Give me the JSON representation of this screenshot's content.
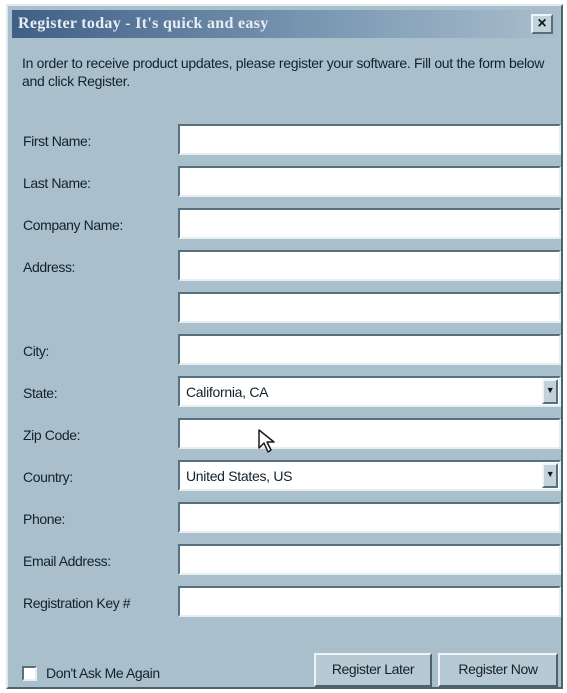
{
  "window": {
    "title": "Register today - It's quick and easy",
    "close_label": "×"
  },
  "intro_text": "In order to receive product updates, please register your software.  Fill out the form below and click Register.",
  "fields": {
    "first_name": {
      "label": "First Name:",
      "value": ""
    },
    "last_name": {
      "label": "Last Name:",
      "value": ""
    },
    "company_name": {
      "label": "Company Name:",
      "value": ""
    },
    "address": {
      "label": "Address:",
      "value": "",
      "value2": ""
    },
    "city": {
      "label": "City:",
      "value": ""
    },
    "state": {
      "label": "State:",
      "value": "California, CA"
    },
    "zip_code": {
      "label": "Zip Code:",
      "value": ""
    },
    "country": {
      "label": "Country:",
      "value": "United States, US"
    },
    "phone": {
      "label": "Phone:",
      "value": ""
    },
    "email": {
      "label": "Email Address:",
      "value": ""
    },
    "reg_key": {
      "label": "Registration Key #",
      "value": ""
    }
  },
  "footer": {
    "dont_ask_label": "Don't Ask Me Again",
    "dont_ask_checked": false,
    "register_later_label": "Register Later",
    "register_now_label": "Register Now"
  },
  "icons": {
    "dropdown": "chevron-down-icon",
    "cursor": "mouse-pointer-icon"
  },
  "colors": {
    "window_bg": "#a9bfcb",
    "title_gradient_start": "#3f5f86",
    "field_bg": "#ffffff"
  }
}
